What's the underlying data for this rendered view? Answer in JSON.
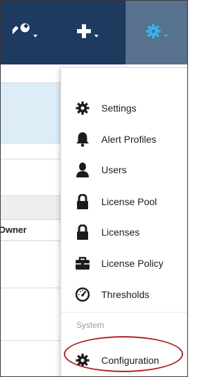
{
  "navbar": {
    "buttons": [
      {
        "icon": "wrench-icon",
        "color": "#ffffff"
      },
      {
        "icon": "plus-icon",
        "color": "#ffffff"
      },
      {
        "icon": "gear-icon",
        "color": "#36b4e8"
      }
    ],
    "background": "#1f3a5f",
    "active_background": "#57718e"
  },
  "background_page": {
    "column_header": "Owner"
  },
  "menu": {
    "items": [
      {
        "label": "Settings",
        "icon": "gear-icon"
      },
      {
        "label": "Alert Profiles",
        "icon": "bell-icon"
      },
      {
        "label": "Users",
        "icon": "user-icon"
      },
      {
        "label": "License Pool",
        "icon": "lock-icon"
      },
      {
        "label": "Licenses",
        "icon": "lock-icon"
      },
      {
        "label": "License Policy",
        "icon": "briefcase-icon"
      },
      {
        "label": "Thresholds",
        "icon": "gauge-icon"
      }
    ],
    "section_label": "System",
    "system_items": [
      {
        "label": "Configuration",
        "icon": "gear-icon"
      }
    ]
  },
  "annotation": {
    "color": "#b32525",
    "target": "Configuration"
  }
}
